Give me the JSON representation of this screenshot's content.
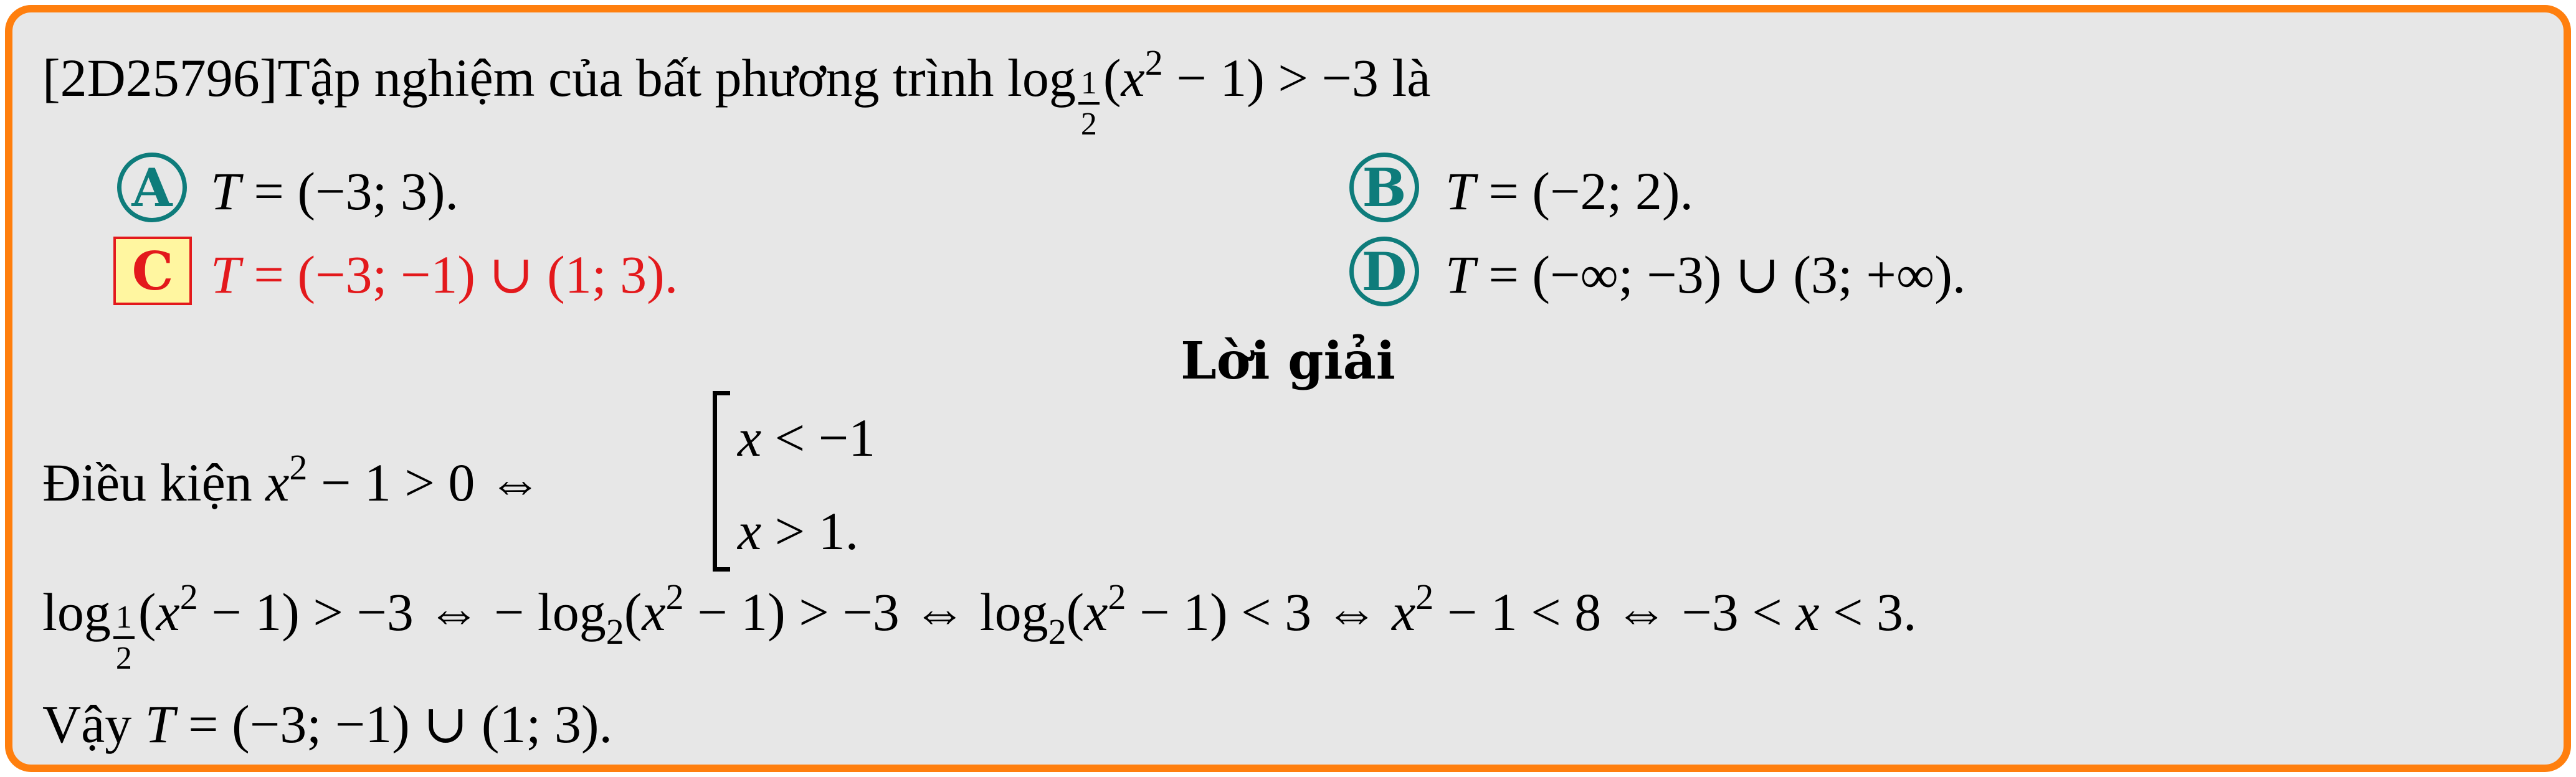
{
  "question": {
    "code": "[2D25796]",
    "stem": "Tập nghiệm của bất phương trình",
    "log_base_num": "1",
    "log_base_den": "2",
    "ineq_tail": "> −3 là"
  },
  "options": [
    {
      "letter": "A",
      "text": "= (−3; 3).",
      "correct": false
    },
    {
      "letter": "B",
      "text": "= (−2; 2).",
      "correct": false
    },
    {
      "letter": "C",
      "text": "= (−3; −1) ∪ (1; 3).",
      "correct": true
    },
    {
      "letter": "D",
      "text": "= (−∞; −3) ∪ (3; +∞).",
      "correct": false
    }
  ],
  "solution": {
    "title": "Lời giải",
    "condition_label": "Điều kiện",
    "condition_rhs": "− 1 > 0 ⇔",
    "case1": "< −1",
    "case2": "> 1.",
    "line2_part1": "> −3 ⇔ −",
    "line2_part2": "> −3 ⇔",
    "line2_part3": "< 3 ⇔",
    "line2_part4": "− 1 < 8 ⇔ −3 <",
    "line2_part5": "< 3.",
    "conclusion_label": "Vậy",
    "conclusion_rhs": "= (−3; −1) ∪ (1; 3)."
  },
  "colors": {
    "frame": "#ff7f0e",
    "background": "#e7e7e7",
    "option_badge": "#0e7c7b",
    "correct_answer": "#e3191c",
    "correct_badge_fill": "#fff6a0"
  }
}
